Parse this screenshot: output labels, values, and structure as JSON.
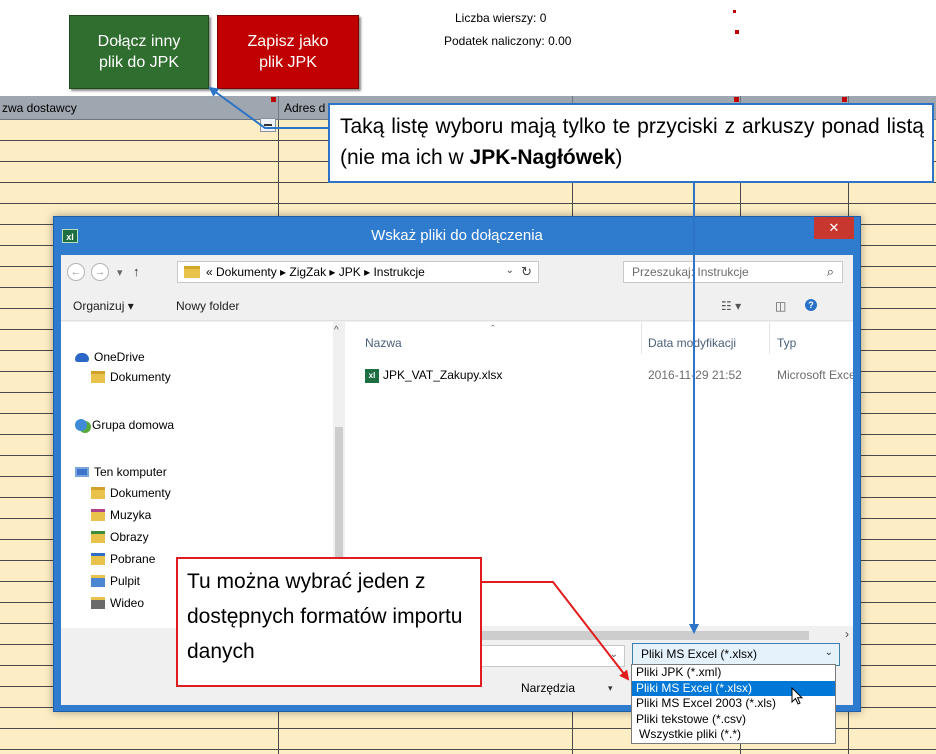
{
  "sheet": {
    "btn_attach": "Dołącz inny\nplik do JPK",
    "btn_save": "Zapisz jako\nplik JPK",
    "info_rows": "Liczba wierszy: 0",
    "info_tax": "Podatek naliczony: 0.00",
    "col_supplier_name": "zwa dostawcy",
    "col_supplier_address": "Adres d"
  },
  "callouts": {
    "top_text_1": "Taką listę wyboru mają tylko te przyciski z arkuszy ponad listą (nie ma ich w ",
    "top_text_bold": "JPK-Nagłówek",
    "top_text_2": ")",
    "bottom_text": "Tu można wybrać jeden z dostępnych formatów importu danych"
  },
  "dialog": {
    "title": "Wskaż pliki do dołączenia",
    "close_glyph": "✕",
    "app_icon": "xl",
    "address": {
      "back_icon": "←",
      "forward_icon": "→",
      "recent_icon": "▾",
      "up_icon": "↑",
      "path": "« Dokumenty ▸ ZigZak ▸ JPK ▸ Instrukcje",
      "dropdown_icon": "⌄",
      "refresh_icon": "↻"
    },
    "search": {
      "placeholder": "Przeszukaj: Instrukcje",
      "icon": "⌕"
    },
    "toolbar": {
      "organize": "Organizuj ▾",
      "new_folder": "Nowy folder",
      "view_icon": "☷ ▾",
      "pane_icon": "◫",
      "help_icon": "?"
    },
    "nav": {
      "onedrive": "OneDrive",
      "onedrive_docs": "Dokumenty",
      "homegroup": "Grupa domowa",
      "this_pc": "Ten komputer",
      "pc_docs": "Dokumenty",
      "music": "Muzyka",
      "pictures": "Obrazy",
      "downloads": "Pobrane",
      "desktop": "Pulpit",
      "videos": "Wideo"
    },
    "columns": {
      "name": "Nazwa",
      "modified": "Data modyfikacji",
      "type": "Typ"
    },
    "files": [
      {
        "name": "JPK_VAT_Zakupy.xlsx",
        "modified": "2016-11-29 21:52",
        "type": "Microsoft Excel"
      }
    ],
    "filetype_selected": "Pliki MS Excel (*.xlsx)",
    "filetype_options": [
      "Pliki JPK (*.xml)",
      "Pliki MS Excel (*.xlsx)",
      "Pliki MS Excel 2003 (*.xls)",
      "Pliki tekstowe (*.csv)",
      "Wszystkie pliki (*.*)"
    ],
    "tools_label": "Narzędzia",
    "tools_arrow": "▾",
    "scroll_right": "›",
    "sort_caret": "ˆ"
  },
  "colors": {
    "grid_fill": "#fdedc4",
    "attach_button": "#2f6e2f",
    "save_button": "#c00000",
    "dialog_frame": "#2f7ccf",
    "callout_blue": "#2d74c7",
    "callout_red": "#e01c1c",
    "selected_option": "#0078d7"
  }
}
